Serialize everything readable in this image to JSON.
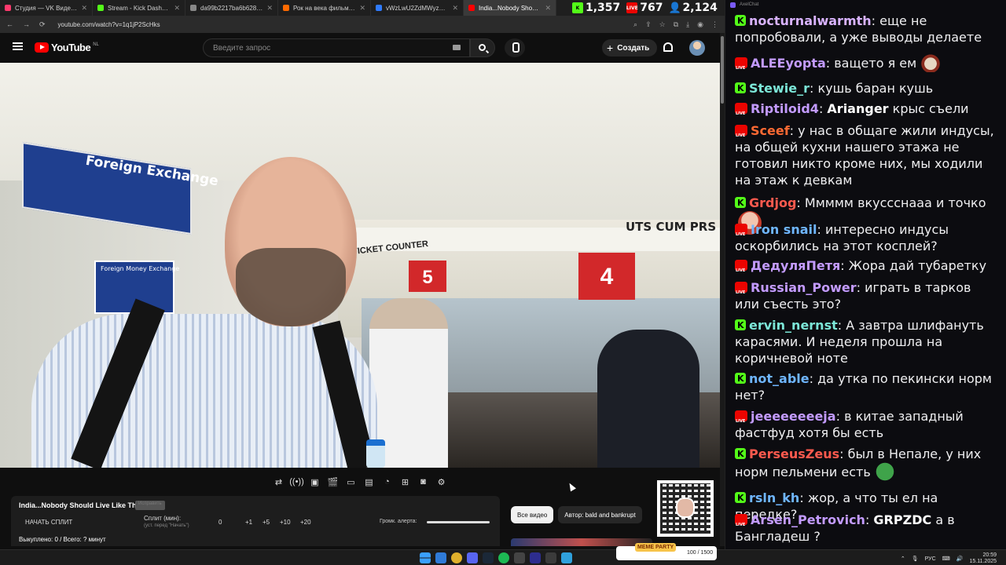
{
  "browser": {
    "tabs": [
      {
        "title": "Студия — VK Видео Live",
        "color": "#ff3a6e",
        "active": false
      },
      {
        "title": "Stream - Kick Dashboard",
        "color": "#53fc18",
        "active": false
      },
      {
        "title": "da99b2217ba6b628.jpg (1358×...",
        "color": "#888888",
        "active": false
      },
      {
        "title": "Рок на века фильм, 2012, дата...",
        "color": "#ff6a00",
        "active": false
      },
      {
        "title": "vWzLwU2ZdMWyzuwLtuQaDTi...",
        "color": "#2f7bff",
        "active": false
      },
      {
        "title": "India...Nobody Should Live...",
        "color": "#ff0000",
        "active": true
      }
    ],
    "url": "youtube.com/watch?v=1q1jP2ScHks"
  },
  "stream_stats": {
    "kick_viewers": "1,357",
    "live_viewers": "767",
    "total_viewers": "2,124"
  },
  "youtube": {
    "logo_text": "YouTube",
    "region": "NL",
    "search_placeholder": "Введите запрос",
    "create_label": "Создать"
  },
  "video": {
    "scene_text": {
      "foreign_exchange": "Foreign Exchange",
      "money_exchange": "Foreign Money Exchange",
      "counter_sign": "UTS CUM PRS",
      "ticket_counter": "TICKET COUNTER",
      "window_5": "5",
      "window_4": "4"
    }
  },
  "split_panel": {
    "title": "India...Nobody Should Live Like This",
    "fix_label": "Исправить",
    "start_split": "НАЧАТЬ СПЛИТ",
    "split_min_label": "Сплит (мин):",
    "split_min_sub": "(уст. перед \"Начать\")",
    "split_value": "0",
    "increments": [
      "+1",
      "+5",
      "+10",
      "+20"
    ],
    "alert_label": "Громк. алерта:",
    "bought_label": "Выкуплено: 0 / Всего: ? минут"
  },
  "chips": [
    {
      "label": "Все видео",
      "active": true
    },
    {
      "label": "Автор: bald and bankrupt",
      "active": false
    }
  ],
  "chat": {
    "window_title": "AxelChat",
    "messages": [
      {
        "platform": "kick",
        "user": "nocturnalwarmth",
        "color": "#d9b3ff",
        "text": "еще не попробовали, а уже выводы делаете",
        "mention": "",
        "emote": ""
      },
      {
        "platform": "live",
        "user": "ALEEyopta",
        "color": "#c39bff",
        "text": "ващето я ем",
        "mention": "",
        "emote": "sack"
      },
      {
        "platform": "kick",
        "user": "Stewie_r",
        "color": "#7ce7d8",
        "text": "кушь баран кушь",
        "mention": "",
        "emote": ""
      },
      {
        "platform": "live",
        "user": "Riptiloid4",
        "color": "#c39bff",
        "text": "крыс съели",
        "mention": "Arianger",
        "emote": ""
      },
      {
        "platform": "live",
        "user": "Sceef",
        "color": "#ff6a33",
        "text": "у нас в общаге жили индусы, на общей кухни нашего этажа не готовил никто кроме них, мы ходили на этаж к девкам",
        "mention": "",
        "emote": ""
      },
      {
        "platform": "kick",
        "user": "Grdjog",
        "color": "#ff5a4e",
        "text": "Ммммм вкуссснааа и точко",
        "mention": "",
        "emote": "face"
      },
      {
        "platform": "live",
        "user": "Iron snail",
        "color": "#6fb6ff",
        "text": "интересно индусы оскорбились на этот косплей?",
        "mention": "",
        "emote": ""
      },
      {
        "platform": "live",
        "user": "ДедуляПетя",
        "color": "#c39bff",
        "text": "Жора дай тубаретку",
        "mention": "",
        "emote": ""
      },
      {
        "platform": "live",
        "user": "Russian_Power",
        "color": "#c39bff",
        "text": "играть в тарков или съесть это?",
        "mention": "",
        "emote": ""
      },
      {
        "platform": "kick",
        "user": "ervin_nernst",
        "color": "#7ce7d8",
        "text": "А завтра шлифануть карасями. И неделя прошла на коричневой ноте",
        "mention": "",
        "emote": ""
      },
      {
        "platform": "kick",
        "user": "not_able",
        "color": "#6fb6ff",
        "text": "да утка по пекински норм нет?",
        "mention": "",
        "emote": ""
      },
      {
        "platform": "live",
        "user": "jeeeeeeeeja",
        "color": "#c39bff",
        "text": "в китае западный фастфуд хотя бы есть",
        "mention": "",
        "emote": ""
      },
      {
        "platform": "kick",
        "user": "PerseusZeus",
        "color": "#ff5a4e",
        "text": "был в Непале, у них норм пельмени есть",
        "mention": "",
        "emote": "pepe"
      },
      {
        "platform": "kick",
        "user": "rsln_kh",
        "color": "#6fb6ff",
        "text": "жор, а что ты ел на передке?",
        "mention": "",
        "emote": ""
      },
      {
        "platform": "live",
        "user": "Arsen_Petrovich",
        "color": "#c39bff",
        "text": "а в Бангладеш ?",
        "mention": "GRPZDC",
        "emote": ""
      }
    ]
  },
  "taskbar": {
    "memeparty_label": "MEME PARTY",
    "memeparty_count": "100 / 1500",
    "lang": "РУС",
    "time": "20:59",
    "date": "15.11.2025"
  }
}
